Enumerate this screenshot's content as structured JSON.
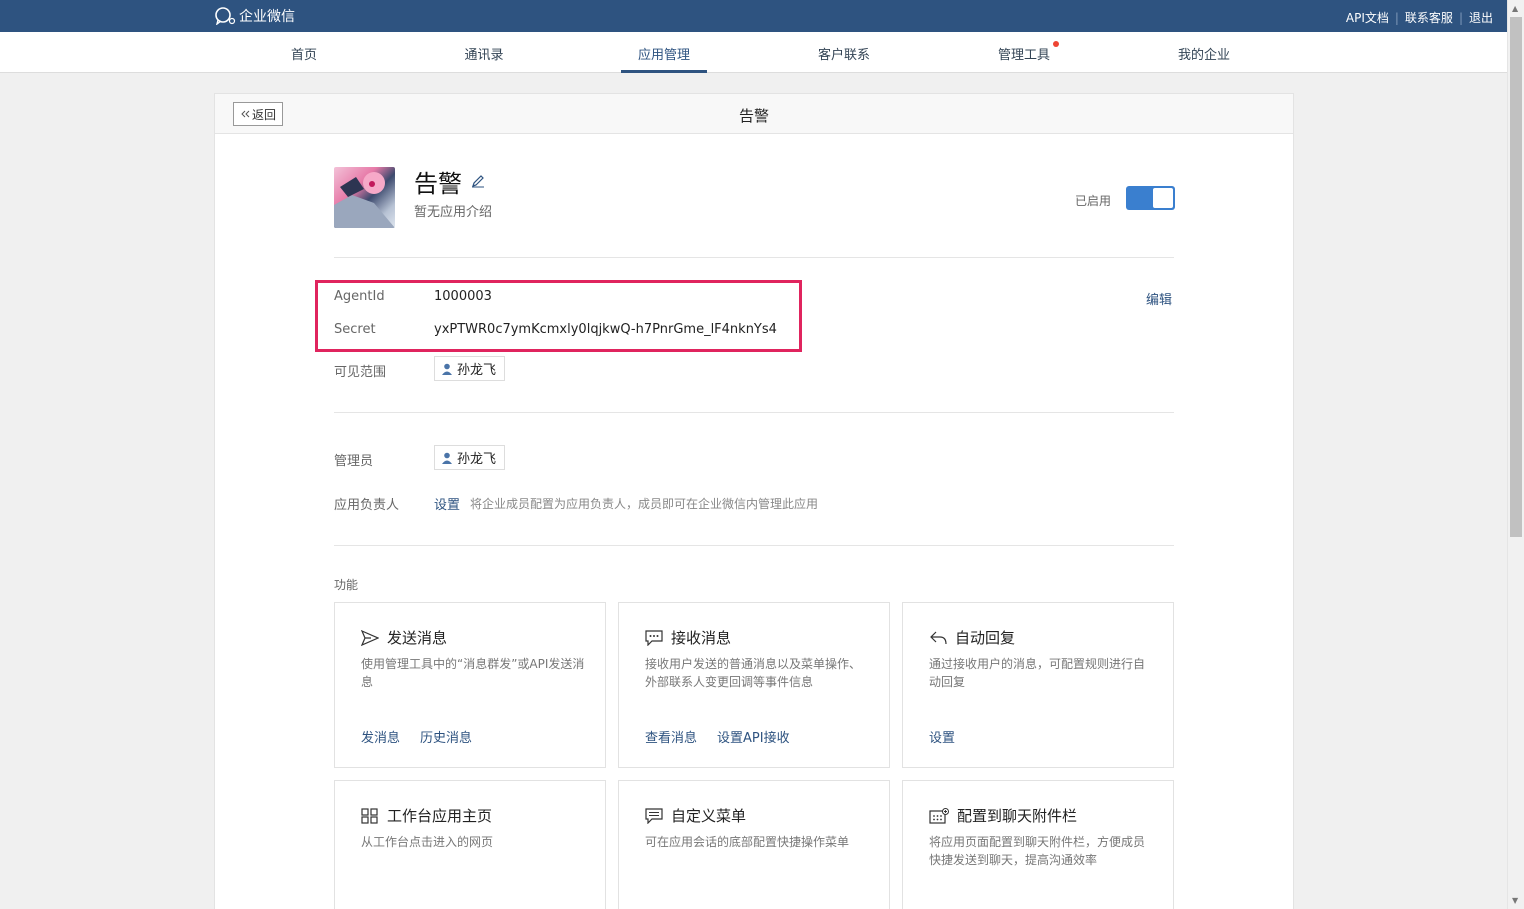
{
  "topbar": {
    "brand": "企业微信",
    "links": [
      "API文档",
      "联系客服",
      "退出"
    ],
    "separator": "|"
  },
  "nav": {
    "items": [
      "首页",
      "通讯录",
      "应用管理",
      "客户联系",
      "管理工具",
      "我的企业"
    ],
    "active": "应用管理"
  },
  "page": {
    "back_label": "返回",
    "title": "告警"
  },
  "app": {
    "name": "告警",
    "description": "暂无应用介绍",
    "status_label": "已启用",
    "enabled": true
  },
  "credentials": {
    "agentid_label": "AgentId",
    "agentid_value": "1000003",
    "secret_label": "Secret",
    "secret_value": "yxPTWR0c7ymKcmxly0lqjkwQ-h7PnrGme_lF4nknYs4",
    "edit_label": "编辑"
  },
  "visibility": {
    "label": "可见范围",
    "member": "孙龙飞"
  },
  "admin": {
    "label": "管理员",
    "member": "孙龙飞"
  },
  "owner": {
    "label": "应用负责人",
    "set_label": "设置",
    "hint": "将企业成员配置为应用负责人，成员即可在企业微信内管理此应用"
  },
  "features": {
    "section_label": "功能",
    "cards": [
      {
        "icon": "send-icon",
        "title": "发送消息",
        "desc": "使用管理工具中的“消息群发”或API发送消息",
        "actions": [
          "发消息",
          "历史消息"
        ]
      },
      {
        "icon": "receive-message-icon",
        "title": "接收消息",
        "desc": "接收用户发送的普通消息以及菜单操作、外部联系人变更回调等事件信息",
        "actions": [
          "查看消息",
          "设置API接收"
        ]
      },
      {
        "icon": "reply-icon",
        "title": "自动回复",
        "desc": "通过接收用户的消息，可配置规则进行自动回复",
        "actions": [
          "设置"
        ]
      },
      {
        "icon": "grid-icon",
        "title": "工作台应用主页",
        "desc": "从工作台点击进入的网页",
        "actions": []
      },
      {
        "icon": "menu-icon",
        "title": "自定义菜单",
        "desc": "可在应用会话的底部配置快捷操作菜单",
        "actions": []
      },
      {
        "icon": "chat-toolbar-icon",
        "title": "配置到聊天附件栏",
        "desc": "将应用页面配置到聊天附件栏，方便成员快捷发送到聊天，提高沟通效率",
        "actions": []
      }
    ]
  }
}
